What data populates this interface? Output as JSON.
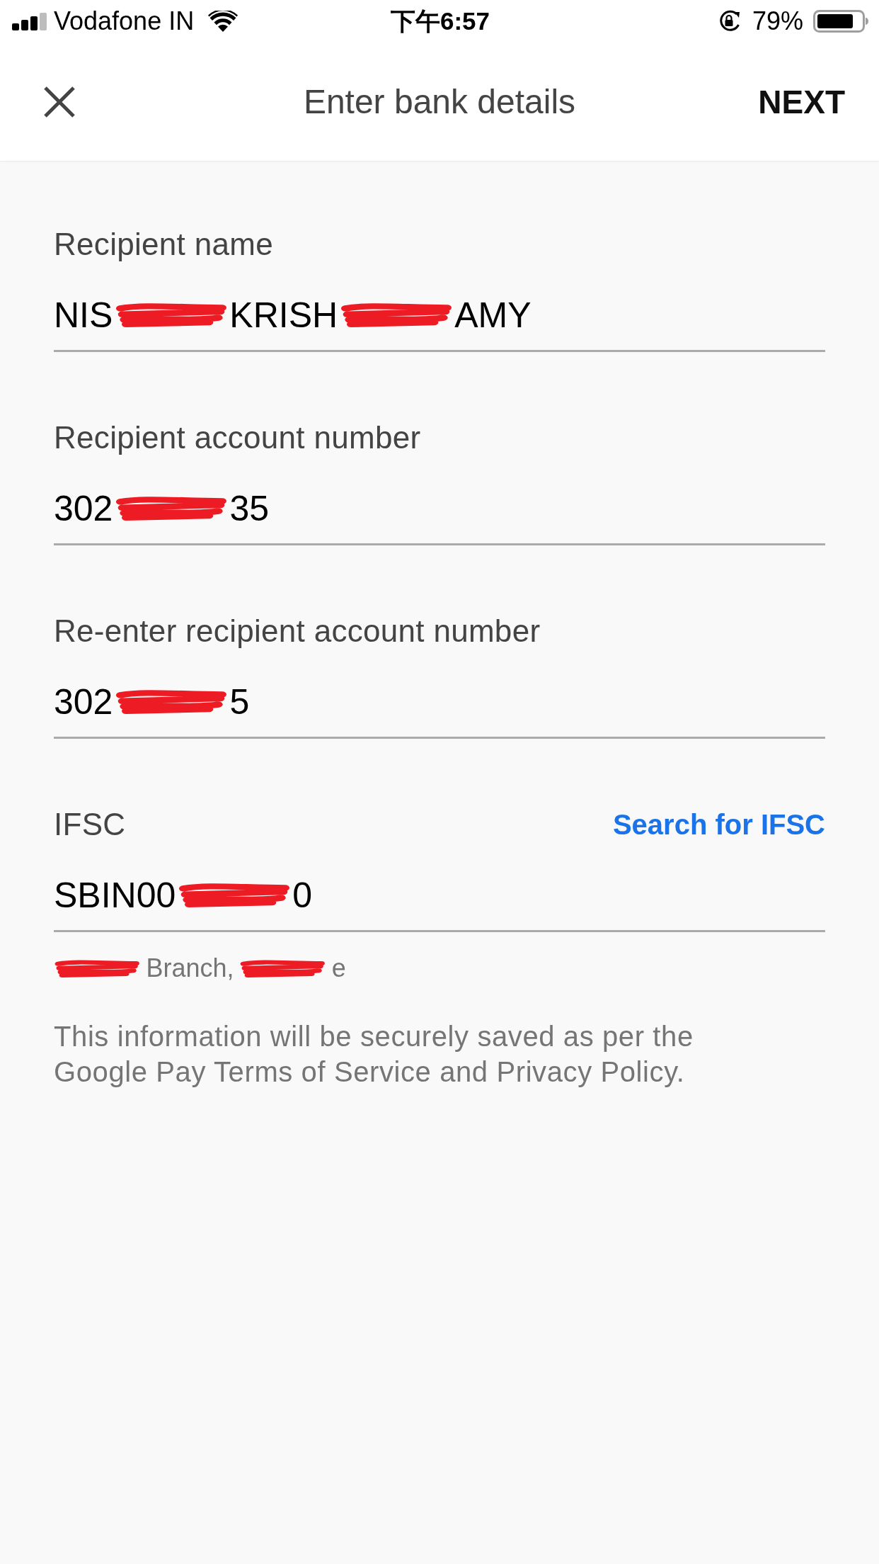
{
  "status_bar": {
    "carrier": "Vodafone IN",
    "time": "下午6:57",
    "battery": "79%"
  },
  "header": {
    "title": "Enter bank details",
    "action": "NEXT"
  },
  "fields": [
    {
      "label": "Recipient name",
      "value": [
        {
          "kind": "text",
          "text": "NIS"
        },
        {
          "kind": "redacted"
        },
        {
          "kind": "text",
          "text": "KRISH"
        },
        {
          "kind": "redacted"
        },
        {
          "kind": "text",
          "text": "AMY"
        }
      ]
    },
    {
      "label": "Recipient account number",
      "value": [
        {
          "kind": "text",
          "text": "302"
        },
        {
          "kind": "redacted"
        },
        {
          "kind": "text",
          "text": "35"
        }
      ]
    },
    {
      "label": "Re-enter recipient account number",
      "value": [
        {
          "kind": "text",
          "text": "302"
        },
        {
          "kind": "redacted"
        },
        {
          "kind": "text",
          "text": "5"
        }
      ]
    },
    {
      "label": "IFSC",
      "link": "Search for IFSC",
      "value": [
        {
          "kind": "text",
          "text": "SBIN00"
        },
        {
          "kind": "redacted"
        },
        {
          "kind": "text",
          "text": "0"
        }
      ]
    }
  ],
  "branch": [
    {
      "kind": "redacted"
    },
    {
      "kind": "text",
      "text": "Branch,"
    },
    {
      "kind": "redacted"
    },
    {
      "kind": "text",
      "text": "e"
    }
  ],
  "notice": "This information will be securely saved as per the Google Pay Terms of Service and Privacy Policy."
}
